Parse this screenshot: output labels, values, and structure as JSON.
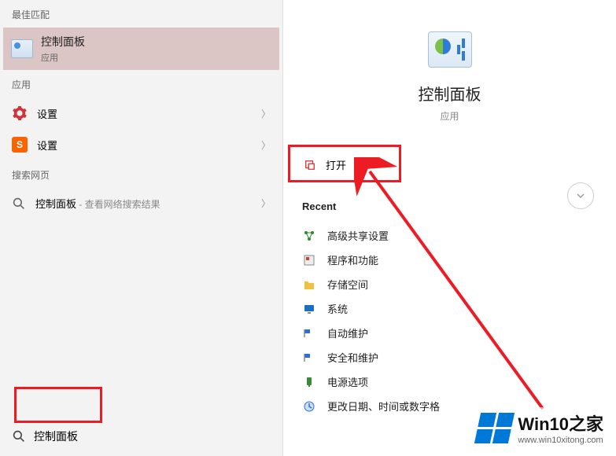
{
  "left": {
    "bestMatchHeader": "最佳匹配",
    "bestMatch": {
      "title": "控制面板",
      "sub": "应用"
    },
    "appsHeader": "应用",
    "apps": [
      {
        "label": "设置"
      },
      {
        "label": "设置"
      }
    ],
    "webHeader": "搜索网页",
    "web": {
      "label": "控制面板",
      "sub": " - 查看网络搜索结果"
    },
    "search": {
      "value": "控制面板"
    }
  },
  "right": {
    "hero": {
      "title": "控制面板",
      "sub": "应用"
    },
    "openAction": "打开",
    "recentHeader": "Recent",
    "recent": [
      {
        "label": "高级共享设置",
        "iconColor": "#2a8a2a"
      },
      {
        "label": "程序和功能",
        "iconColor": "#5a5a5a"
      },
      {
        "label": "存储空间",
        "iconColor": "#f0c040"
      },
      {
        "label": "系统",
        "iconColor": "#1a6fc4"
      },
      {
        "label": "自动维护",
        "iconColor": "#2a6fd6"
      },
      {
        "label": "安全和维护",
        "iconColor": "#2a6fd6"
      },
      {
        "label": "电源选项",
        "iconColor": "#3a8a3a"
      },
      {
        "label": "更改日期、时间或数字格",
        "iconColor": "#2a6fd6"
      }
    ]
  },
  "watermark": {
    "title": "Win10之家",
    "url": "www.win10xitong.com"
  }
}
